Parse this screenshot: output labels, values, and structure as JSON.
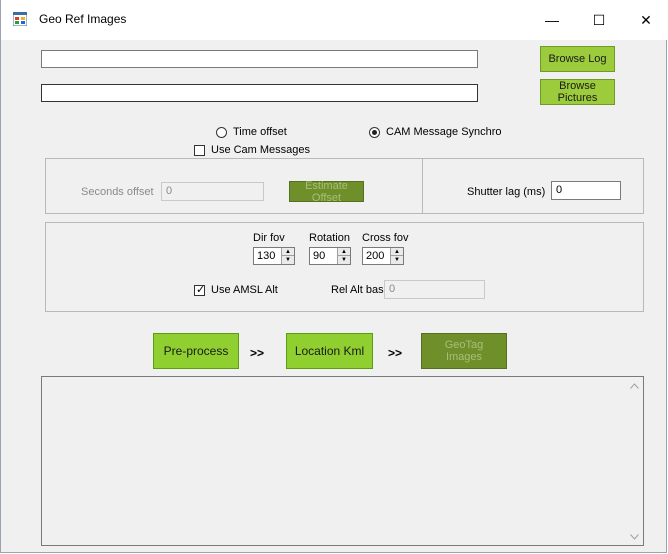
{
  "window": {
    "title": "Geo Ref Images",
    "minimize_glyph": "—",
    "maximize_glyph": "☐",
    "close_glyph": "✕"
  },
  "files": {
    "log_path": "",
    "pictures_path": "",
    "browse_log_label": "Browse Log",
    "browse_pictures_label": "Browse Pictures"
  },
  "sync_mode": {
    "time_offset_label": "Time offset",
    "cam_message_label": "CAM Message Synchro",
    "selected": "CAM Message Synchro",
    "use_cam_messages_label": "Use Cam Messages",
    "use_cam_messages_checked": false
  },
  "offset": {
    "seconds_offset_label": "Seconds offset",
    "seconds_offset_value": "0",
    "estimate_offset_label": "Estimate Offset"
  },
  "shutter": {
    "label": "Shutter lag (ms)",
    "value": "0"
  },
  "camera": {
    "dir_fov_label": "Dir fov",
    "dir_fov_value": "130",
    "rotation_label": "Rotation",
    "rotation_value": "90",
    "cross_fov_label": "Cross fov",
    "cross_fov_value": "200",
    "use_amsl_alt_label": "Use AMSL Alt",
    "use_amsl_alt_checked": true,
    "rel_alt_base_label": "Rel Alt base",
    "rel_alt_base_value": "0"
  },
  "actions": {
    "preprocess_label": "Pre-process",
    "location_kml_label": "Location Kml",
    "geotag_label": "GeoTag Images",
    "separator": ">>"
  },
  "log": {
    "text": ""
  },
  "icons": {
    "app": "app-window-icon",
    "scroll_up": "scroll-up-arrow-icon",
    "scroll_down": "scroll-down-arrow-icon",
    "check": "checkmark-icon"
  }
}
